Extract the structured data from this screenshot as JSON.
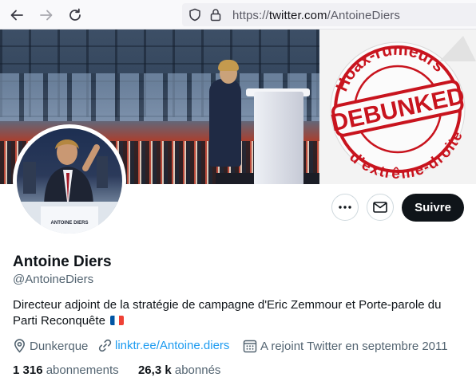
{
  "browser": {
    "url_prefix": "https://",
    "url_domain": "twitter.com",
    "url_path": "/AntoineDiers"
  },
  "banner": {
    "stamp_top_text": "Hoax-rumeurs",
    "stamp_main_text": "DEBUNKED",
    "stamp_bottom_text": "d'extrême-droite",
    "podium_sign": "ANTOINE DIERS"
  },
  "actions": {
    "more_icon": "more-icon",
    "message_icon": "mail-icon",
    "follow_label": "Suivre"
  },
  "profile": {
    "name": "Antoine Diers",
    "handle": "@AntoineDiers",
    "bio": "Directeur adjoint de la stratégie de campagne d'Eric Zemmour et Porte-parole du Parti Reconquête",
    "bio_emoji": "france-flag",
    "location": "Dunkerque",
    "website": "linktr.ee/Antoine.diers",
    "joined": "A rejoint Twitter en septembre 2011"
  },
  "stats": {
    "following_count": "1 316",
    "following_label": "abonnements",
    "followers_count": "26,3 k",
    "followers_label": "abonnés"
  },
  "colors": {
    "link": "#1d9bf0",
    "stamp_red": "#c8141e",
    "button_dark": "#0f1419"
  }
}
